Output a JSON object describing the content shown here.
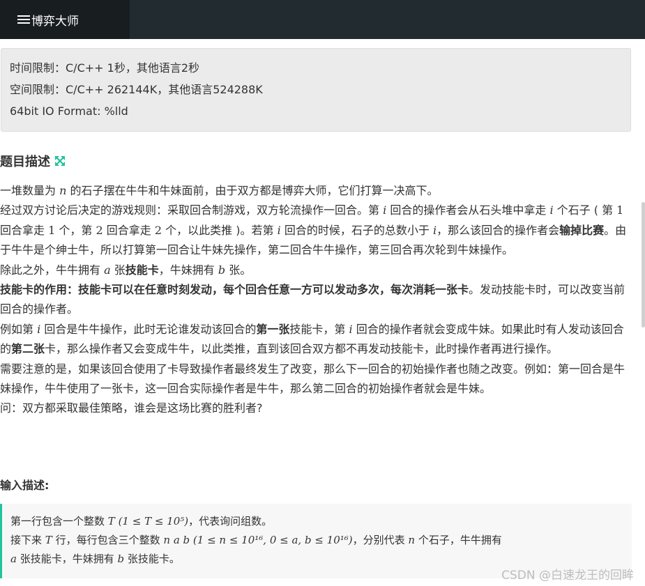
{
  "nav": {
    "brand_label": "博弈大师"
  },
  "limits": {
    "time": "时间限制：C/C++ 1秒，其他语言2秒",
    "space": "空间限制：C/C++ 262144K，其他语言524288K",
    "format": "64bit IO Format: %lld"
  },
  "problem": {
    "title": "题目描述",
    "p1a": "一堆数量为",
    "p1b": "的石子摆在牛牛和牛妹面前，由于双方都是博弈大师，它们打算一决高下。",
    "p2a": "经过双方讨论后决定的游戏规则：采取回合制游戏，双方轮流操作一回合。第",
    "p2b": "回合的操作者会从石头堆中拿走",
    "p2c": "个石子 ( 第",
    "p2d": "回合拿走",
    "p2e": "个，第",
    "p2f": "回合拿走",
    "p2g": "个，以此类推 )。若第",
    "p2h": "回合的时候，石子的总数小于",
    "p2i": "，那么该回合的操作者会",
    "p2_bold": "输掉比赛",
    "p2j": "。由于牛牛是个绅士牛，所以打算第一回合让牛妹先操作，第二回合牛牛操作，第三回合再次轮到牛妹操作。",
    "p3a": "除此之外，牛牛拥有",
    "p3b": "张",
    "p3_bold": "技能卡",
    "p3c": "，牛妹拥有",
    "p3d": "张。",
    "p4_bold": "技能卡的作用：技能卡可以在任意时刻发动，每个回合任意一方可以发动多次，每次消耗一张卡",
    "p4a": "。发动技能卡时，可以改变当前回合的操作者。",
    "p5a": "例如第",
    "p5b": "回合是牛牛操作，此时无论谁发动该回合的",
    "p5_bold1": "第一张",
    "p5c": "技能卡，第",
    "p5d": "回合的操作者就会变成牛妹。如果此时有人发动该回合的",
    "p5_bold2": "第二张",
    "p5e": "卡，那么操作者又会变成牛牛，以此类推，直到该回合双方都不再发动技能卡，此时操作者再进行操作。",
    "p6": "需要注意的是，如果该回合使用了卡导致操作者最终发生了改变，那么下一回合的初始操作者也随之改变。例如：第一回合是牛妹操作，牛牛使用了一张卡，这一回合实际操作者是牛牛，那么第二回合的初始操作者就会是牛妹。",
    "p7": "问：双方都采取最佳策略，谁会是这场比赛的胜利者?",
    "var_n": "n",
    "var_i": "i",
    "var_a": "a",
    "var_b": "b",
    "num_1": "1",
    "num_2": "2"
  },
  "input": {
    "title": "输入描述:",
    "line1a": "第一行包含一个整数",
    "line1_math": "T (1 ≤ T ≤ 10⁵)",
    "line1b": "，代表询问组数。",
    "line2a": "接下来",
    "line2_T": "T",
    "line2b": "行，每行包含三个整数",
    "line2_math": "n a b (1 ≤ n ≤ 10¹⁶, 0 ≤ a, b ≤ 10¹⁶)",
    "line2c": "，分别代表",
    "line2_n": "n",
    "line2d": "个石子，牛牛拥有",
    "line3_a": "a",
    "line3a": "张技能卡，牛妹拥有",
    "line3_b": "b",
    "line3b": "张技能卡。"
  },
  "watermark": "CSDN @白速龙王的回眸",
  "colors": {
    "accent": "#22c39b",
    "topbar": "#222b30",
    "brand_bg": "#181d20"
  }
}
